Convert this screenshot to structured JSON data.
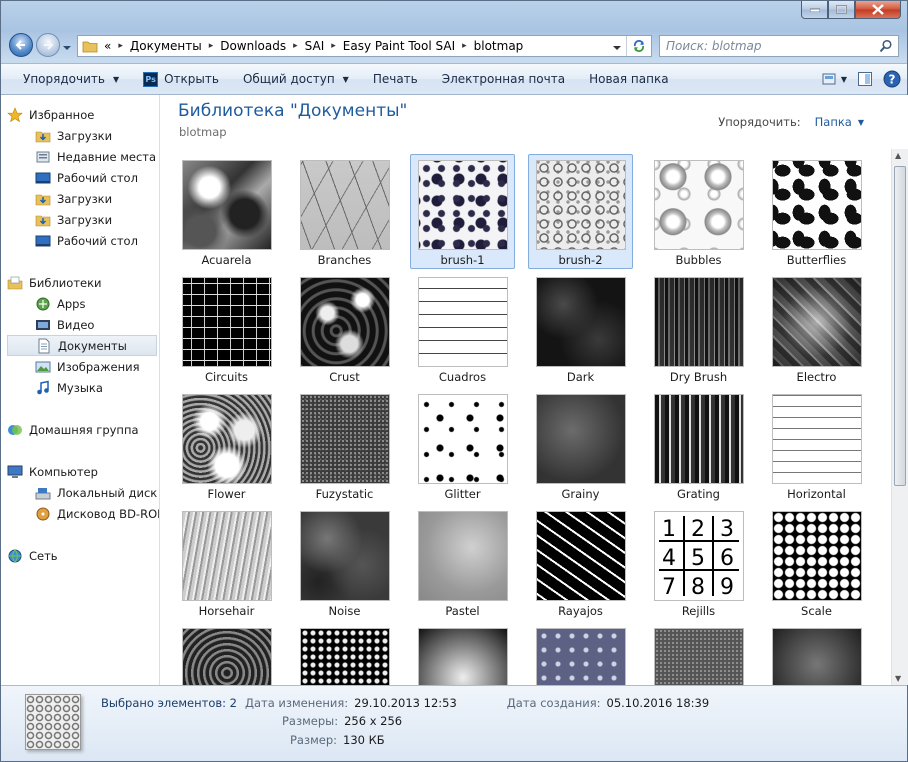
{
  "address": {
    "overflow": "«",
    "crumbs": [
      "Документы",
      "Downloads",
      "SAI",
      "Easy Paint Tool SAI",
      "blotmap"
    ]
  },
  "search": {
    "placeholder": "Поиск: blotmap"
  },
  "toolbar": {
    "organize": "Упорядочить",
    "open": "Открыть",
    "share": "Общий доступ",
    "print": "Печать",
    "email": "Электронная почта",
    "new_folder": "Новая папка"
  },
  "nav": {
    "favorites": "Избранное",
    "fav_items": [
      "Загрузки",
      "Недавние места",
      "Рабочий стол",
      "Загрузки",
      "Загрузки",
      "Рабочий стол"
    ],
    "libraries": "Библиотеки",
    "lib_items": [
      "Apps",
      "Видео",
      "Документы",
      "Изображения",
      "Музыка"
    ],
    "homegroup": "Домашняя группа",
    "computer": "Компьютер",
    "computer_items": [
      "Локальный диск (C",
      "Дисковод BD-ROM"
    ],
    "network": "Сеть"
  },
  "content": {
    "title": "Библиотека \"Документы\"",
    "subtitle": "blotmap",
    "arrange_label": "Упорядочить:",
    "arrange_value": "Папка"
  },
  "files": [
    {
      "name": "Acuarela",
      "tex": "t-acuarela",
      "selected": false
    },
    {
      "name": "Branches",
      "tex": "t-branches",
      "selected": false
    },
    {
      "name": "brush-1",
      "tex": "t-brush1",
      "selected": true
    },
    {
      "name": "brush-2",
      "tex": "t-brush2",
      "selected": true
    },
    {
      "name": "Bubbles",
      "tex": "t-bubbles",
      "selected": false
    },
    {
      "name": "Butterflies",
      "tex": "t-butterflies",
      "selected": false
    },
    {
      "name": "Circuits",
      "tex": "t-circuits",
      "selected": false
    },
    {
      "name": "Crust",
      "tex": "t-crust",
      "selected": false
    },
    {
      "name": "Cuadros",
      "tex": "t-cuadros",
      "selected": false
    },
    {
      "name": "Dark",
      "tex": "t-dark",
      "selected": false
    },
    {
      "name": "Dry Brush",
      "tex": "t-drybrush",
      "selected": false
    },
    {
      "name": "Electro",
      "tex": "t-electro",
      "selected": false
    },
    {
      "name": "Flower",
      "tex": "t-flower",
      "selected": false
    },
    {
      "name": "Fuzystatic",
      "tex": "t-fuzzy",
      "selected": false
    },
    {
      "name": "Glitter",
      "tex": "t-glitter",
      "selected": false
    },
    {
      "name": "Grainy",
      "tex": "t-grainy",
      "selected": false
    },
    {
      "name": "Grating",
      "tex": "t-grating",
      "selected": false
    },
    {
      "name": "Horizontal",
      "tex": "t-horizontal",
      "selected": false
    },
    {
      "name": "Horsehair",
      "tex": "t-horsehair",
      "selected": false
    },
    {
      "name": "Noise",
      "tex": "t-noise",
      "selected": false
    },
    {
      "name": "Pastel",
      "tex": "t-pastel",
      "selected": false
    },
    {
      "name": "Rayajos",
      "tex": "t-rayajos",
      "selected": false
    },
    {
      "name": "Rejills",
      "tex": "t-rejills",
      "selected": false
    },
    {
      "name": "Scale",
      "tex": "t-scale",
      "selected": false
    },
    {
      "name": "",
      "tex": "t-r6a",
      "selected": false
    },
    {
      "name": "",
      "tex": "t-r6b",
      "selected": false
    },
    {
      "name": "",
      "tex": "t-r6c",
      "selected": false
    },
    {
      "name": "",
      "tex": "t-r6d",
      "selected": false
    },
    {
      "name": "",
      "tex": "t-r6e",
      "selected": false
    },
    {
      "name": "",
      "tex": "t-r6f",
      "selected": false
    }
  ],
  "rejills_digits": [
    "1",
    "2",
    "3",
    "4",
    "5",
    "6",
    "7",
    "8",
    "9"
  ],
  "details": {
    "count_label": "Выбрано элементов: 2",
    "modified_label": "Дата изменения:",
    "modified_value": "29.10.2013 12:53",
    "created_label": "Дата создания:",
    "created_value": "05.10.2016 18:39",
    "dimensions_label": "Размеры:",
    "dimensions_value": "256 x 256",
    "size_label": "Размер:",
    "size_value": "130 КБ"
  },
  "colors": {
    "accent": "#1e5b9e",
    "selection": "#d9e9fb",
    "selection_border": "#84acdd"
  }
}
